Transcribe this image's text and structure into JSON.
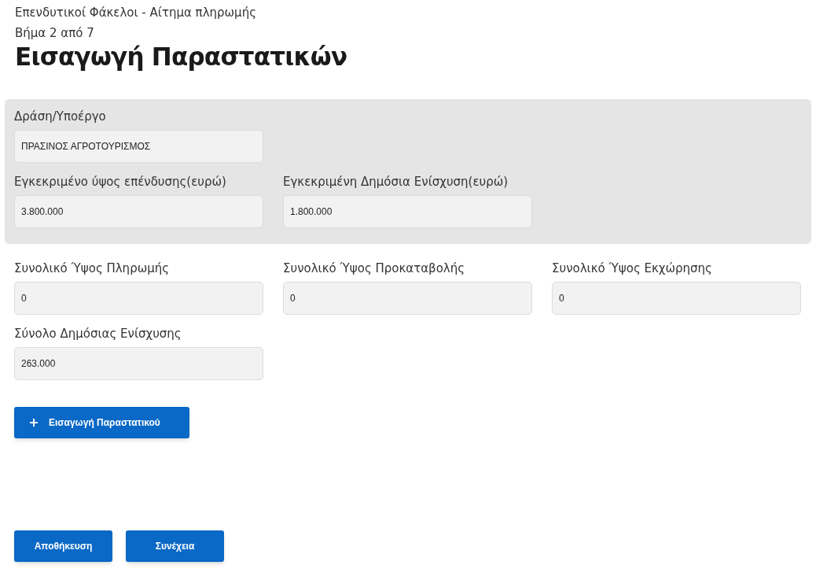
{
  "header": {
    "breadcrumb": "Επενδυτικοί Φάκελοι - Αίτημα πληρωμής",
    "step": "Βήμα 2 από 7",
    "title": "Εισαγωγή Παραστατικών"
  },
  "approved_panel": {
    "rows": [
      [
        {
          "label": "Δράση/Υποέργο",
          "value": "ΠΡΑΣΙΝΟΣ ΑΓΡΟΤΟΥΡΙΣΜΟΣ"
        }
      ],
      [
        {
          "label": "Εγκεκριμένο ύψος επένδυσης(ευρώ)",
          "value": "3.800.000"
        },
        {
          "label": "Εγκεκριμένη Δημόσια Ενίσχυση(ευρώ)",
          "value": "1.800.000"
        }
      ]
    ]
  },
  "totals": [
    {
      "label": "Συνολικό Ύψος Πληρωμής",
      "value": "0"
    },
    {
      "label": "Συνολικό Ύψος Προκαταβολής",
      "value": "0"
    },
    {
      "label": "Συνολικό Ύψος Εκχώρησης",
      "value": "0"
    },
    {
      "label": "Σύνολο Δημόσιας Ενίσχυσης",
      "value": "263.000"
    }
  ],
  "add_button": {
    "label": "Εισαγωγή Παραστατικού"
  },
  "footer_buttons": [
    "Αποθήκευση",
    "Συνέχεια"
  ]
}
